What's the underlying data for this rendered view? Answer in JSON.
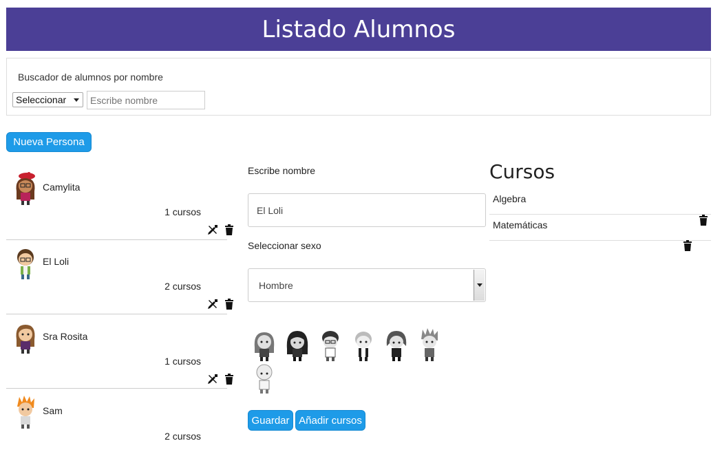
{
  "header": {
    "title": "Listado Alumnos"
  },
  "search": {
    "label": "Buscador de alumnos por nombre",
    "select_value": "Seleccionar",
    "input_placeholder": "Escribe nombre"
  },
  "new_person_label": "Nueva Persona",
  "students": [
    {
      "name": "Camylita",
      "courses": "1 cursos",
      "avatar": "girl-red-beret-avatar",
      "editable": true
    },
    {
      "name": "El Loli",
      "courses": "2 cursos",
      "avatar": "boy-glasses-avatar",
      "editable": true
    },
    {
      "name": "Sra Rosita",
      "courses": "1 cursos",
      "avatar": "girl-brown-hair-avatar",
      "editable": true
    },
    {
      "name": "Sam",
      "courses": "2 cursos",
      "avatar": "boy-orange-hair-avatar",
      "editable": false
    }
  ],
  "form": {
    "name_label": "Escribe nombre",
    "name_value": "El Loli",
    "sex_label": "Seleccionar sexo",
    "sex_value": "Hombre",
    "avatar_options": [
      "avatar-option-1",
      "avatar-option-2",
      "avatar-option-3",
      "avatar-option-4",
      "avatar-option-5",
      "avatar-option-6",
      "avatar-option-7"
    ],
    "save_label": "Guardar",
    "add_courses_label": "Añadir cursos"
  },
  "cursos": {
    "title": "Cursos",
    "items": [
      "Algebra",
      "Matemáticas"
    ]
  },
  "colors": {
    "header_bg": "#4b3f96",
    "button_bg": "#1e9be8"
  }
}
